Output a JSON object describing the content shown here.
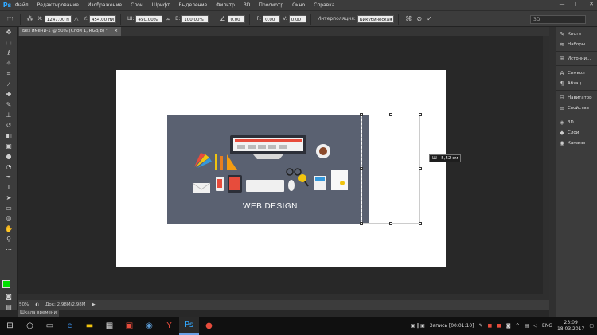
{
  "app": {
    "logo": "Ps",
    "menu": [
      "Файл",
      "Редактирование",
      "Изображение",
      "Слои",
      "Шрифт",
      "Выделение",
      "Фильтр",
      "3D",
      "Просмотр",
      "Окно",
      "Справка"
    ],
    "window_controls": [
      "—",
      "□",
      "✕"
    ]
  },
  "options": {
    "x_label": "X:",
    "x_value": "1247,00 п",
    "y_label": "Y:",
    "y_value": "454,00 пи",
    "w_label": "Ш:",
    "w_value": "450,00%",
    "h_label": "В:",
    "h_value": "100,00%",
    "angle_value": "0,00",
    "hskew_label": "Г:",
    "hskew_value": "0,00",
    "vskew_label": "V:",
    "vskew_value": "0,00",
    "interp_label": "Интерполяция:",
    "interp_value": "Бикубическая",
    "workspace_value": "3D"
  },
  "document": {
    "tab_title": "Без имени-1 @ 50% (Слой 1, RGB/8) *",
    "tab_close": "×",
    "layer_title": "WEB DESIGN",
    "tooltip": "Ш :  5,52 см",
    "colors": {
      "canvas_bg": "#ffffff",
      "layer": "#5a6171",
      "foreground": "#00e000",
      "background": "#ffffff"
    }
  },
  "status": {
    "zoom": "50%",
    "doc_size": "Док: 2,98M/2,98M",
    "timeline_tab": "Шкала времени"
  },
  "panels": {
    "group1": [
      {
        "icon": "brush-icon",
        "glyph": "✎",
        "label": "Кисть"
      },
      {
        "icon": "brush-presets-icon",
        "glyph": "≋",
        "label": "Наборы ..."
      }
    ],
    "group2": [
      {
        "icon": "source-icon",
        "glyph": "⊞",
        "label": "Источни..."
      }
    ],
    "group3": [
      {
        "icon": "character-icon",
        "glyph": "A",
        "label": "Символ"
      },
      {
        "icon": "paragraph-icon",
        "glyph": "¶",
        "label": "Абзац"
      }
    ],
    "group4": [
      {
        "icon": "navigator-icon",
        "glyph": "⊟",
        "label": "Навигатор"
      },
      {
        "icon": "properties-icon",
        "glyph": "≡",
        "label": "Свойства"
      }
    ],
    "group5": [
      {
        "icon": "3d-icon",
        "glyph": "◈",
        "label": "3D"
      },
      {
        "icon": "layers-icon",
        "glyph": "◆",
        "label": "Слои"
      },
      {
        "icon": "channels-icon",
        "glyph": "◉",
        "label": "Каналы"
      }
    ]
  },
  "taskbar": {
    "recording": "Запись [00:01:10]",
    "lang": "ENG",
    "time": "23:09",
    "date": "18.03.2017"
  }
}
